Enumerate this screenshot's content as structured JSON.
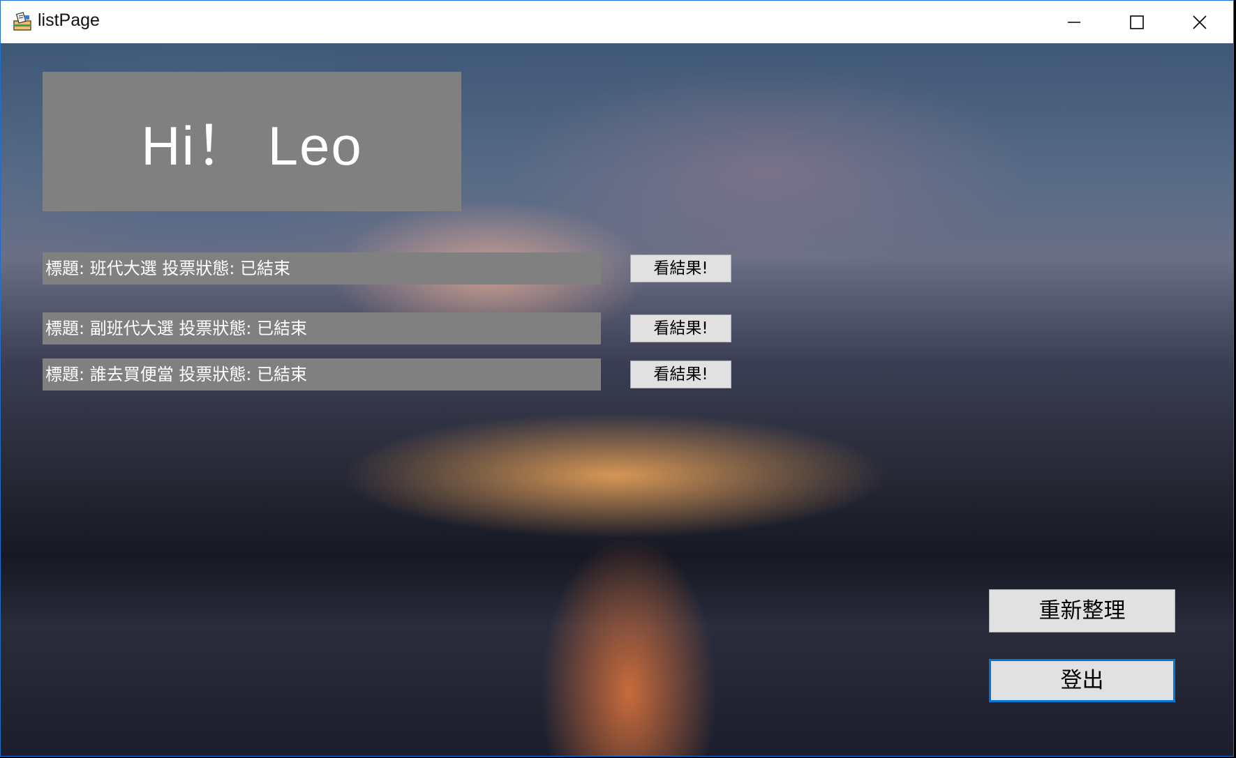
{
  "window": {
    "title": "listPage",
    "icon": "app-icon",
    "controls": {
      "minimize_icon": "minimize-icon",
      "maximize_icon": "maximize-icon",
      "close_icon": "close-icon"
    }
  },
  "greeting": {
    "text": "Hi！ Leo"
  },
  "polls": [
    {
      "label": "標題: 班代大選  投票狀態: 已結束",
      "button": "看結果!"
    },
    {
      "label": "標題: 副班代大選  投票狀態: 已結束",
      "button": "看結果!"
    },
    {
      "label": "標題: 誰去買便當  投票狀態: 已結束",
      "button": "看結果!"
    }
  ],
  "actions": {
    "refresh_label": "重新整理",
    "logout_label": "登出"
  },
  "colors": {
    "panel_gray": "#808080",
    "button_face": "#e1e1e1",
    "focus_border": "#0078d7",
    "window_border": "#1e6fd0"
  }
}
